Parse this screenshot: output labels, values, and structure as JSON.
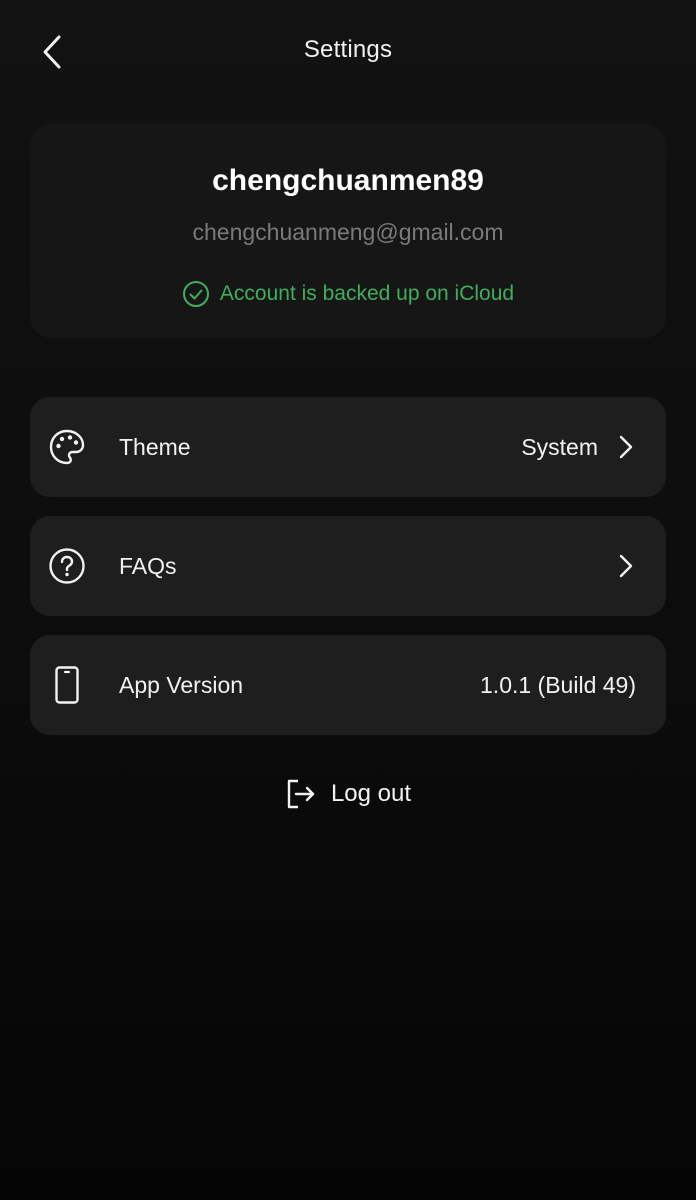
{
  "header": {
    "title": "Settings",
    "back_icon": "chevron-left-icon"
  },
  "profile": {
    "username": "chengchuanmen89",
    "email": "chengchuanmeng@gmail.com",
    "backup_status": "Account is backed up on iCloud",
    "backup_color": "#3fae5d"
  },
  "settings": {
    "theme": {
      "label": "Theme",
      "value": "System",
      "icon": "palette-icon"
    },
    "faqs": {
      "label": "FAQs",
      "icon": "question-circle-icon"
    },
    "app_version": {
      "label": "App Version",
      "value": "1.0.1 (Build 49)",
      "icon": "phone-icon"
    }
  },
  "logout": {
    "label": "Log out",
    "icon": "logout-icon"
  },
  "colors": {
    "background": "#121212",
    "card": "#1e1e1e",
    "muted_text": "#7a7a7a"
  }
}
